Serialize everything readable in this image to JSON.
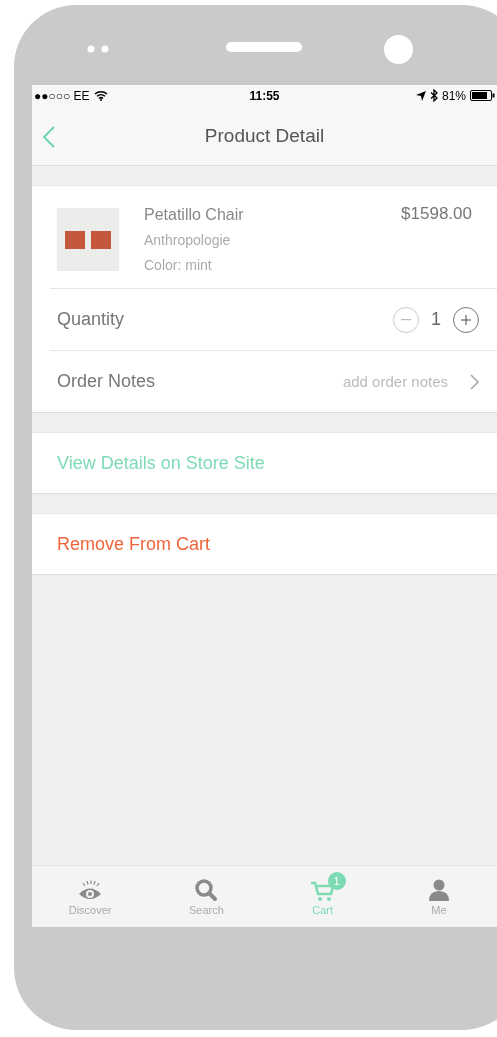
{
  "status_bar": {
    "carrier": "●●○○○ EE",
    "time": "11:55",
    "battery": "81%"
  },
  "nav": {
    "title": "Product Detail"
  },
  "product": {
    "name": "Petatillo Chair",
    "brand": "Anthropologie",
    "variant": "Color: mint",
    "price": "$1598.00"
  },
  "quantity": {
    "label": "Quantity",
    "value": "1",
    "decrease_disabled": true
  },
  "order_notes": {
    "label": "Order Notes",
    "placeholder": "add order notes"
  },
  "actions": [
    {
      "label": "View Details on Store Site",
      "kind": "link"
    },
    {
      "label": "Remove From Cart",
      "kind": "destructive"
    }
  ],
  "tab_bar": [
    {
      "label": "Discover",
      "selected": false
    },
    {
      "label": "Search",
      "selected": false
    },
    {
      "label": "Cart",
      "selected": true,
      "badge": "1"
    },
    {
      "label": "Me",
      "selected": false
    }
  ]
}
